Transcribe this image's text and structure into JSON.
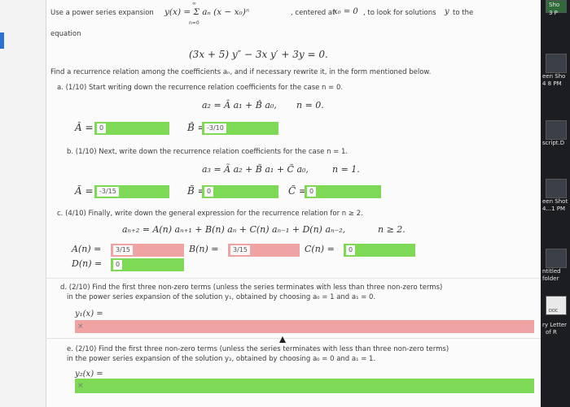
{
  "problem": {
    "intro_a": "Use a power series expansion",
    "series_formula": "y(x) = Σ aₙ (x − x₀)ⁿ",
    "sum_top": "∞",
    "sum_bottom": "n=0",
    "intro_b": ", centered at",
    "center": "x₀ = 0",
    "intro_c": ", to look for solutions",
    "intro_y": "y",
    "intro_d": "to the",
    "line2": "equation",
    "ode": "(3x + 5) y″ − 3x y′ + 3y = 0.",
    "instruction": "Find a recurrence relation among the coefficients aₙ, and if necessary rewrite it, in the form mentioned below."
  },
  "part_a": {
    "prompt": "a. (1/10) Start writing down the recurrence relation coefficients for the case n = 0.",
    "relation": "a₂ = Â a₁ + B̂ a₀,",
    "condition": "n = 0.",
    "A_label": "Â =",
    "A_value": "0",
    "A_status": "correct",
    "B_label": "B̂ =",
    "B_value": "-3/10",
    "B_status": "correct"
  },
  "part_b": {
    "prompt": "b. (1/10) Next, write down the recurrence relation coefficients for the case n = 1.",
    "relation": "a₃ = Ã a₂ + B̃ a₁ + C̃ a₀,",
    "condition": "n = 1.",
    "A_label": "Ã =",
    "A_value": "-3/15",
    "A_status": "correct",
    "B_label": "B̃ =",
    "B_value": "0",
    "B_status": "correct",
    "C_label": "C̃ =",
    "C_value": "0",
    "C_status": "correct"
  },
  "part_c": {
    "prompt": "c. (4/10) Finally, write down the general expression for the recurrence relation for n ≥ 2.",
    "relation": "aₙ₊₂ = A(n) aₙ₊₁ + B(n) aₙ + C(n) aₙ₋₁ + D(n) aₙ₋₂,",
    "condition": "n ≥ 2.",
    "A_label": "A(n) =",
    "A_value": "3/15",
    "A_status": "incorrect",
    "B_label": "B(n) =",
    "B_value": "3/15",
    "B_status": "incorrect",
    "C_label": "C(n) =",
    "C_value": "0",
    "C_status": "correct",
    "D_label": "D(n) =",
    "D_value": "0",
    "D_status": "correct"
  },
  "part_d": {
    "prompt_1": "d. (2/10) Find the first three non-zero terms (unless the series terminates with less than three non-zero terms)",
    "prompt_2": "in the power series expansion of the solution y₁, obtained by choosing a₀ = 1 and a₁ = 0.",
    "answer_label": "y₁(x) =",
    "answer_mark": "×",
    "status": "incorrect"
  },
  "part_e": {
    "prompt_1": "e. (2/10) Find the first three non-zero terms (unless the series terminates with less than three non-zero terms)",
    "prompt_2": "in the power series expansion of the solution y₂, obtained by choosing a₀ = 0 and a₁ = 1.",
    "answer_label": "y₂(x) =",
    "answer_mark": "×",
    "status": "correct"
  },
  "desktop": {
    "items": [
      "Sho",
      "3 P",
      "een Sho",
      "4 8 PM",
      "script.D",
      "een Shot",
      "4...1 PM",
      "ntitled",
      "folder",
      "DOC",
      "ry Letter",
      "of R"
    ]
  },
  "colors": {
    "correct": "#7ed957",
    "incorrect": "#f0a3a3",
    "desktop": "#1c1d20"
  }
}
